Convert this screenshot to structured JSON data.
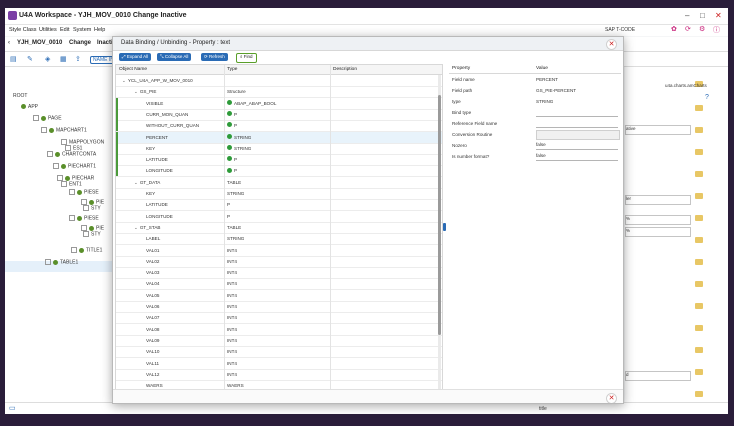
{
  "window": {
    "title": "U4A Workspace - YJH_MOV_0010 Change Inactive"
  },
  "menu": [
    "Style Class",
    "Utilities",
    "Edit",
    "System",
    "Help"
  ],
  "tcode_label": "SAP T-CODE",
  "header": {
    "app_id": "YJH_MOV_0010",
    "mode": "Change",
    "state_short": "Inacti"
  },
  "toolbar": {
    "name_label": "NAME IN"
  },
  "tree": [
    {
      "label": "ROOT"
    },
    {
      "label": "APP"
    },
    {
      "label": "PAGE"
    },
    {
      "label": "MAPCHART1"
    },
    {
      "label": "MAPPOLYGON"
    },
    {
      "label": "ES1"
    },
    {
      "label": "CHARTCONTA"
    },
    {
      "label": "PIECHART1"
    },
    {
      "label": "PIECHAR"
    },
    {
      "label": "ENT1"
    },
    {
      "label": "PIESE"
    },
    {
      "label": "PIE"
    },
    {
      "label": "STY"
    },
    {
      "label": "PIESE"
    },
    {
      "label": "PIE"
    },
    {
      "label": "STY"
    },
    {
      "label": "TITLE1"
    },
    {
      "label": "TABLE1"
    }
  ],
  "right_field_text": "u4a.charts.amCharts",
  "right_values": [
    "ative",
    "ler",
    "%",
    "%",
    "d"
  ],
  "modal": {
    "title": "Data Binding / Unbinding - Property : text",
    "buttons": {
      "expand": "Expand All",
      "collapse": "Collapse All",
      "refresh": "Refresh",
      "find": "Find"
    },
    "grid_headers": {
      "name": "Object Name",
      "type": "Type",
      "desc": "Description"
    },
    "rows": [
      {
        "name": "YCL_U4A_APP_W_MOV_0010",
        "type": "",
        "level": 0,
        "chev": "v"
      },
      {
        "name": "GS_PIE",
        "type": "Structure",
        "level": 1,
        "chev": "v"
      },
      {
        "name": "VISIBLE",
        "type": "ABAP_ABAP_BOOL",
        "level": 2,
        "ok": true
      },
      {
        "name": "CURR_MON_QUAN",
        "type": "P",
        "level": 2,
        "ok": true
      },
      {
        "name": "WITHOUT_CURR_QUAN",
        "type": "P",
        "level": 2,
        "ok": true
      },
      {
        "name": "PERCENT",
        "type": "STRING",
        "level": 2,
        "ok": true,
        "selected": true
      },
      {
        "name": "KEY",
        "type": "STRING",
        "level": 2,
        "ok": true
      },
      {
        "name": "LATITUDE",
        "type": "P",
        "level": 2,
        "ok": true
      },
      {
        "name": "LONGITUDE",
        "type": "P",
        "level": 2,
        "ok": true
      },
      {
        "name": "GT_DATA",
        "type": "TABLE",
        "level": 1,
        "chev": "v"
      },
      {
        "name": "KEY",
        "type": "STRING",
        "level": 2
      },
      {
        "name": "LATITUDE",
        "type": "P",
        "level": 2
      },
      {
        "name": "LONGITUDE",
        "type": "P",
        "level": 2
      },
      {
        "name": "GT_STAB",
        "type": "TABLE",
        "level": 1,
        "chev": "v"
      },
      {
        "name": "LABEL",
        "type": "STRING",
        "level": 2
      },
      {
        "name": "VAL01",
        "type": "INT4",
        "level": 2
      },
      {
        "name": "VAL02",
        "type": "INT4",
        "level": 2
      },
      {
        "name": "VAL03",
        "type": "INT4",
        "level": 2
      },
      {
        "name": "VAL04",
        "type": "INT4",
        "level": 2
      },
      {
        "name": "VAL05",
        "type": "INT4",
        "level": 2
      },
      {
        "name": "VAL06",
        "type": "INT4",
        "level": 2
      },
      {
        "name": "VAL07",
        "type": "INT4",
        "level": 2
      },
      {
        "name": "VAL08",
        "type": "INT4",
        "level": 2
      },
      {
        "name": "VAL09",
        "type": "INT4",
        "level": 2
      },
      {
        "name": "VAL10",
        "type": "INT4",
        "level": 2
      },
      {
        "name": "VAL11",
        "type": "INT4",
        "level": 2
      },
      {
        "name": "VAL12",
        "type": "INT4",
        "level": 2
      },
      {
        "name": "WAERS",
        "type": "WAERS",
        "level": 2
      }
    ],
    "prop_headers": {
      "property": "Property",
      "value": "Value"
    },
    "props": [
      {
        "key": "Field name",
        "value": "PERCENT",
        "kind": "text"
      },
      {
        "key": "Field path",
        "value": "GS_PIE-PERCENT",
        "kind": "text"
      },
      {
        "key": "type",
        "value": "STRING",
        "kind": "text"
      },
      {
        "key": "Bind type",
        "value": "",
        "kind": "field"
      },
      {
        "key": "Reference Field name",
        "value": "",
        "kind": "field"
      },
      {
        "key": "Conversion Routine",
        "value": "",
        "kind": "input"
      },
      {
        "key": "Nozero",
        "value": "false",
        "kind": "field"
      },
      {
        "key": "Is number format?",
        "value": "false",
        "kind": "field"
      }
    ]
  },
  "status_text": "title",
  "colors": {
    "accent": "#2a6bb5",
    "ok": "#2e9b3a",
    "brand": "#7b3fa6"
  }
}
